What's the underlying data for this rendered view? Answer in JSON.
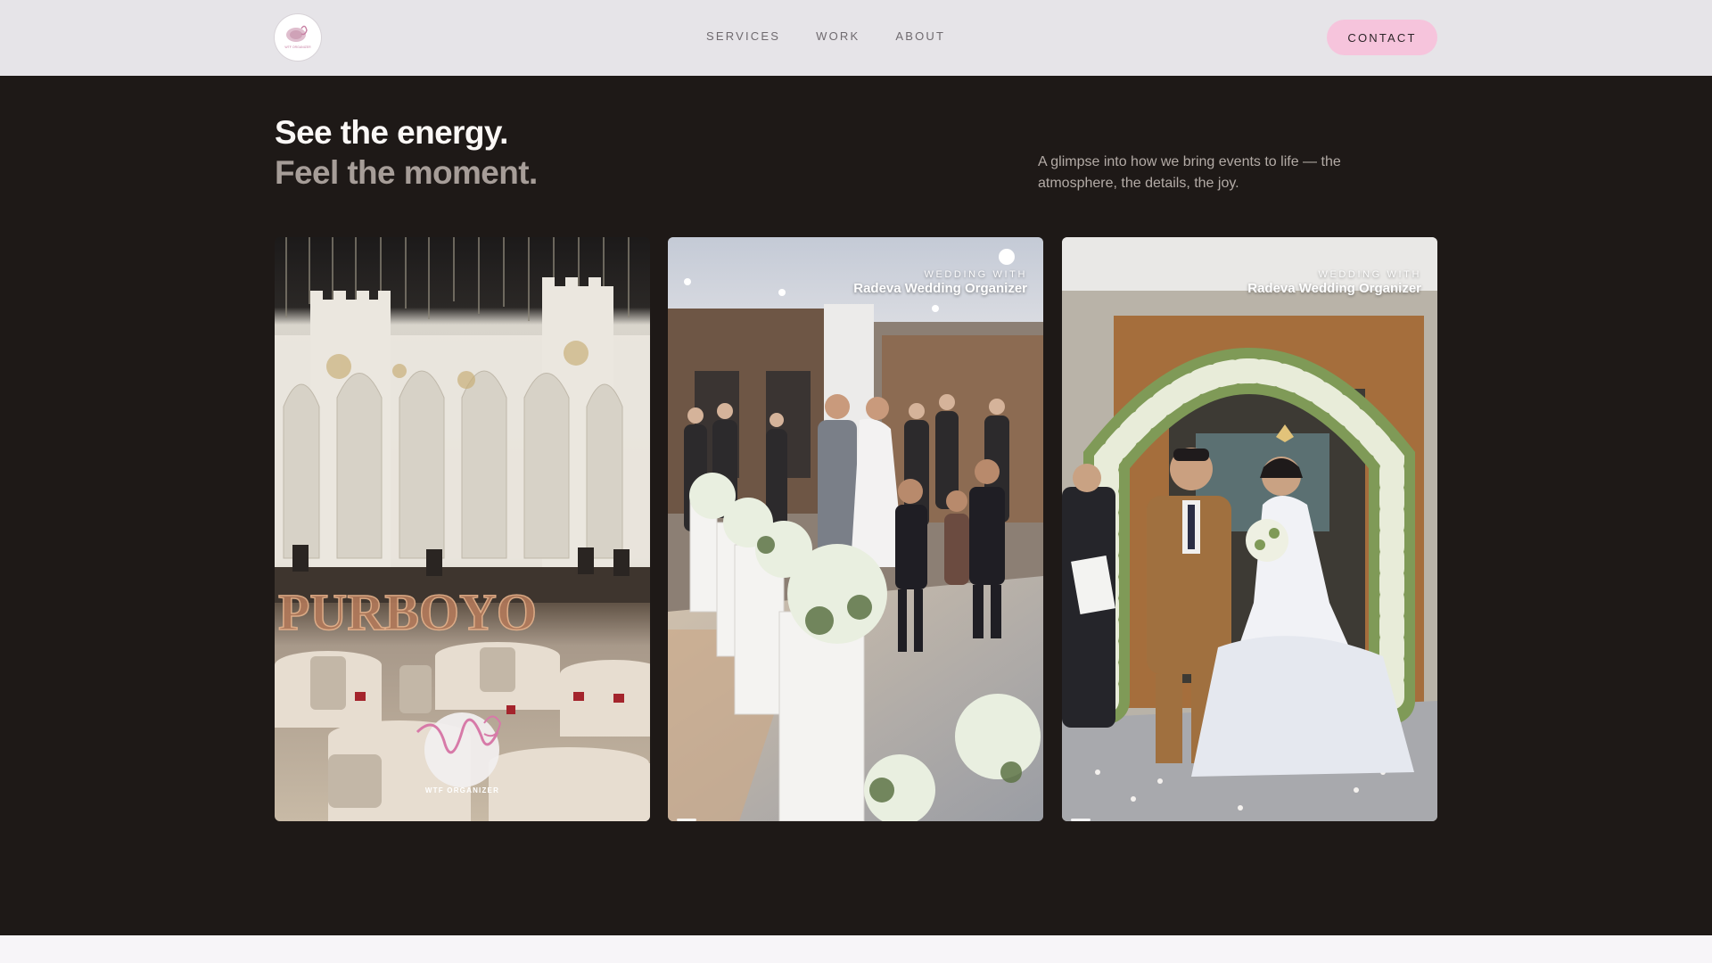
{
  "nav": {
    "logo_caption": "WTF ORGANIZER",
    "links": [
      "SERVICES",
      "WORK",
      "ABOUT"
    ],
    "contact_label": "CONTACT"
  },
  "hero": {
    "headline_1": "See the energy.",
    "headline_2": "Feel the moment.",
    "intro": "A glimpse into how we bring events to life — the atmosphere, the details, the joy."
  },
  "cards": [
    {
      "watermark_caption": "WTF ORGANIZER",
      "signage_text": "PURBOYO"
    },
    {
      "tag_small": "WEDDING WITH",
      "tag_big": "Radeva Wedding Organizer"
    },
    {
      "tag_small": "WEDDING WITH",
      "tag_big": "Radeva Wedding Organizer"
    }
  ],
  "colors": {
    "background": "#1e1917",
    "nav_bg": "#e6e4e8",
    "accent_pink": "#f6c4dc"
  }
}
